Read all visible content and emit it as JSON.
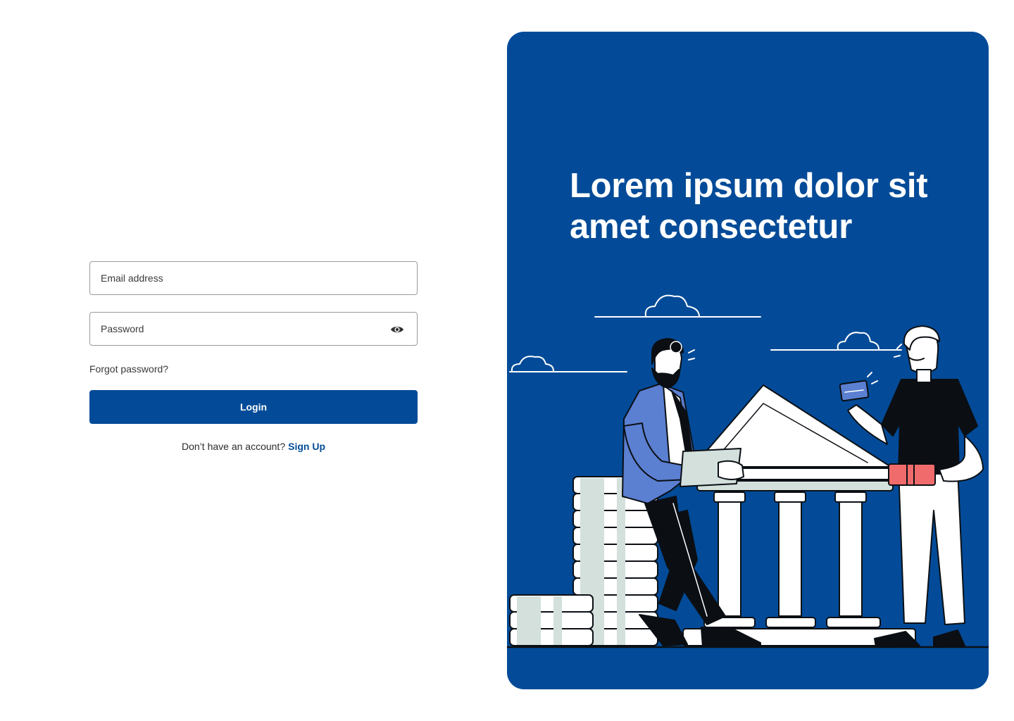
{
  "login_form": {
    "email_placeholder": "Email address",
    "password_placeholder": "Password",
    "show_password_icon": "eye-icon",
    "forgot_password": "Forgot password?",
    "login_button": "Login",
    "signup_prompt": "Don’t have an account?",
    "signup_link": "Sign Up"
  },
  "promo": {
    "headline": "Lorem ipsum dolor sit amet consectetur",
    "illustration": "bank-illustration"
  },
  "colors": {
    "primary": "#034b98",
    "panel_bg": "#034b98",
    "text": "#2b2b2b",
    "accent_blue": "#5b7fd1",
    "accent_red": "#f06b6b",
    "money_green": "#d3e0dc"
  }
}
